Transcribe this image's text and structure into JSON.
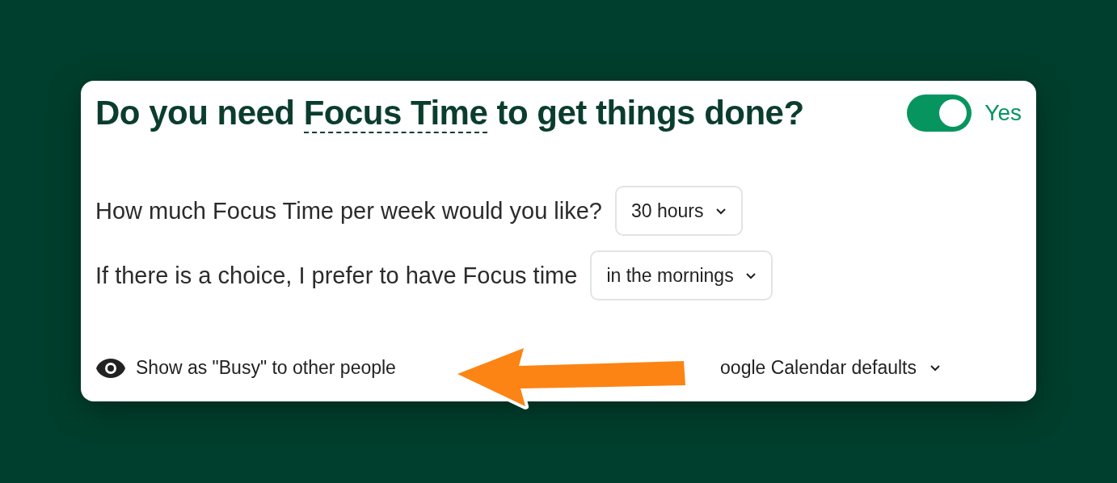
{
  "card": {
    "title_before": "Do you need ",
    "title_term": "Focus Time",
    "title_after": " to get things done?",
    "toggle": {
      "on": true,
      "label": "Yes"
    },
    "questions": [
      {
        "label": "How much Focus Time per week would you like?",
        "value": "30 hours"
      },
      {
        "label": "If there is a choice, I prefer to have Focus time",
        "value": "in the mornings"
      }
    ],
    "visibility": {
      "label": "Show as \"Busy\" to other people"
    },
    "calendar_option": {
      "label": "oogle Calendar defaults"
    }
  },
  "annotation": {
    "kind": "arrow"
  }
}
